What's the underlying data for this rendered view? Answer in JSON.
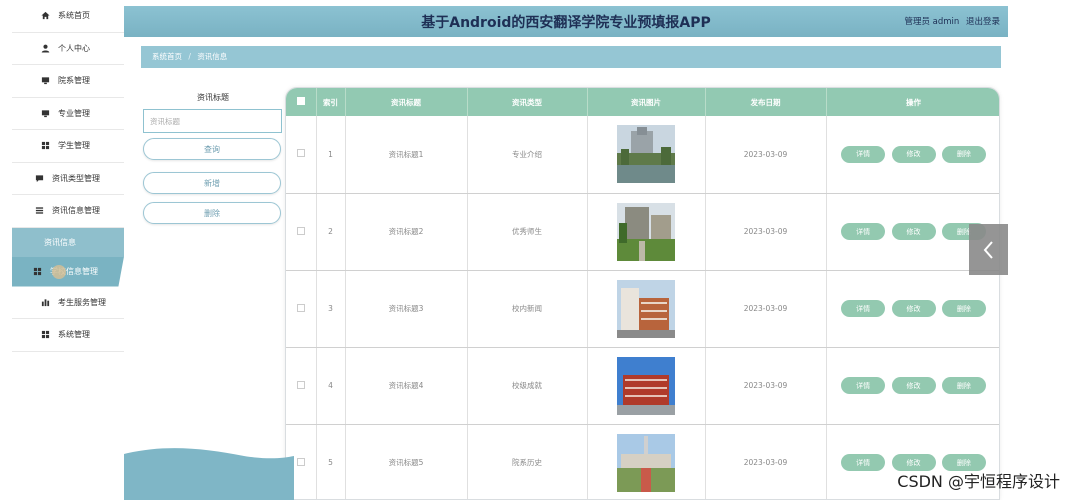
{
  "header": {
    "title": "基于Android的西安翻译学院专业预填报APP",
    "user_label": "管理员 admin",
    "logout": "退出登录"
  },
  "sidebar": {
    "items": [
      {
        "label": "系统首页",
        "icon": "home-icon"
      },
      {
        "label": "个人中心",
        "icon": "user-icon"
      },
      {
        "label": "院系管理",
        "icon": "monitor-icon"
      },
      {
        "label": "专业管理",
        "icon": "monitor-icon"
      },
      {
        "label": "学生管理",
        "icon": "grid-icon"
      },
      {
        "label": "资讯类型管理",
        "icon": "message-icon"
      },
      {
        "label": "资讯信息管理",
        "icon": "list-icon"
      }
    ],
    "sub_item": "资讯信息",
    "active_item": "学校信息管理",
    "items_after": [
      {
        "label": "考生服务管理",
        "icon": "bar-chart-icon"
      },
      {
        "label": "系统管理",
        "icon": "grid-icon"
      }
    ]
  },
  "breadcrumb": {
    "home": "系统首页",
    "separator": "/",
    "current": "资讯信息"
  },
  "search": {
    "label": "资讯标题",
    "placeholder": "资讯标题",
    "query_button": "查询",
    "add_button": "新增",
    "delete_button": "删除"
  },
  "table": {
    "headers": [
      "索引",
      "资讯标题",
      "资讯类型",
      "资讯图片",
      "发布日期",
      "操作"
    ],
    "actions": {
      "detail": "详情",
      "edit": "修改",
      "delete": "删除"
    },
    "rows": [
      {
        "index": "1",
        "title": "资讯标题1",
        "type": "专业介绍",
        "date": "2023-03-09"
      },
      {
        "index": "2",
        "title": "资讯标题2",
        "type": "优秀师生",
        "date": "2023-03-09"
      },
      {
        "index": "3",
        "title": "资讯标题3",
        "type": "校内新闻",
        "date": "2023-03-09"
      },
      {
        "index": "4",
        "title": "资讯标题4",
        "type": "校级成就",
        "date": "2023-03-09"
      },
      {
        "index": "5",
        "title": "资讯标题5",
        "type": "院系历史",
        "date": "2023-03-09"
      }
    ]
  },
  "watermark": "CSDN @宇恒程序设计",
  "colors": {
    "header": "#7fb6c6",
    "table_header": "#92c9b2",
    "action_button": "#93c9b0"
  }
}
